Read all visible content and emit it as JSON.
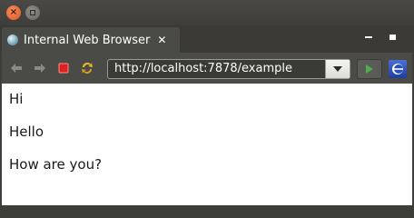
{
  "window": {
    "close_label": "×"
  },
  "tab": {
    "title": "Internal Web Browser",
    "close_label": "✕"
  },
  "toolbar": {
    "url": "http://localhost:7878/example"
  },
  "page": {
    "lines": [
      "Hi",
      "Hello",
      "How are you?"
    ]
  },
  "colors": {
    "close_button": "#e05a20",
    "stop_button": "#e02020",
    "go_button": "#4caf50",
    "accent_blue": "#2a4fc0"
  },
  "icons": {
    "back": "back-arrow-icon",
    "forward": "forward-arrow-icon",
    "stop": "stop-icon",
    "refresh": "refresh-icon",
    "dropdown": "chevron-down-icon",
    "go": "go-play-icon",
    "app": "eclipse-icon"
  }
}
